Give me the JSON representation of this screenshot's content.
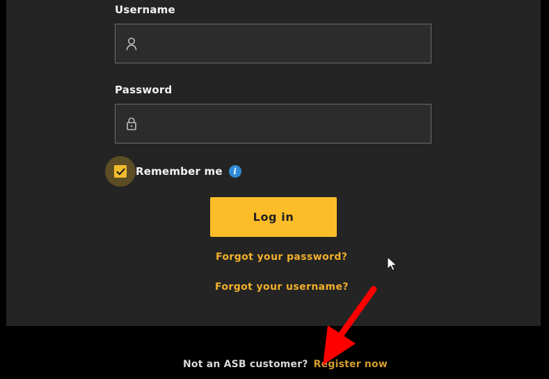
{
  "form": {
    "username_label": "Username",
    "username_value": "",
    "password_label": "Password",
    "password_value": "",
    "remember_label": "Remember me",
    "remember_checked": true,
    "info_glyph": "i",
    "login_label": "Log in",
    "forgot_password_label": "Forgot your password?",
    "forgot_username_label": "Forgot your username?"
  },
  "footer": {
    "question": "Not an ASB customer?",
    "register_label": "Register now"
  },
  "icons": {
    "username": "user-icon",
    "password": "lock-icon",
    "remember": "checkmark-icon",
    "info": "info-icon",
    "cursor": "mouse-pointer-icon",
    "annotation": "red-arrow-icon"
  },
  "colors": {
    "page_background": "#000000",
    "panel_background": "#242424",
    "accent": "#fdbd28",
    "link": "#f2b02b",
    "info": "#2f8bd8",
    "annotation": "#ff0000"
  }
}
